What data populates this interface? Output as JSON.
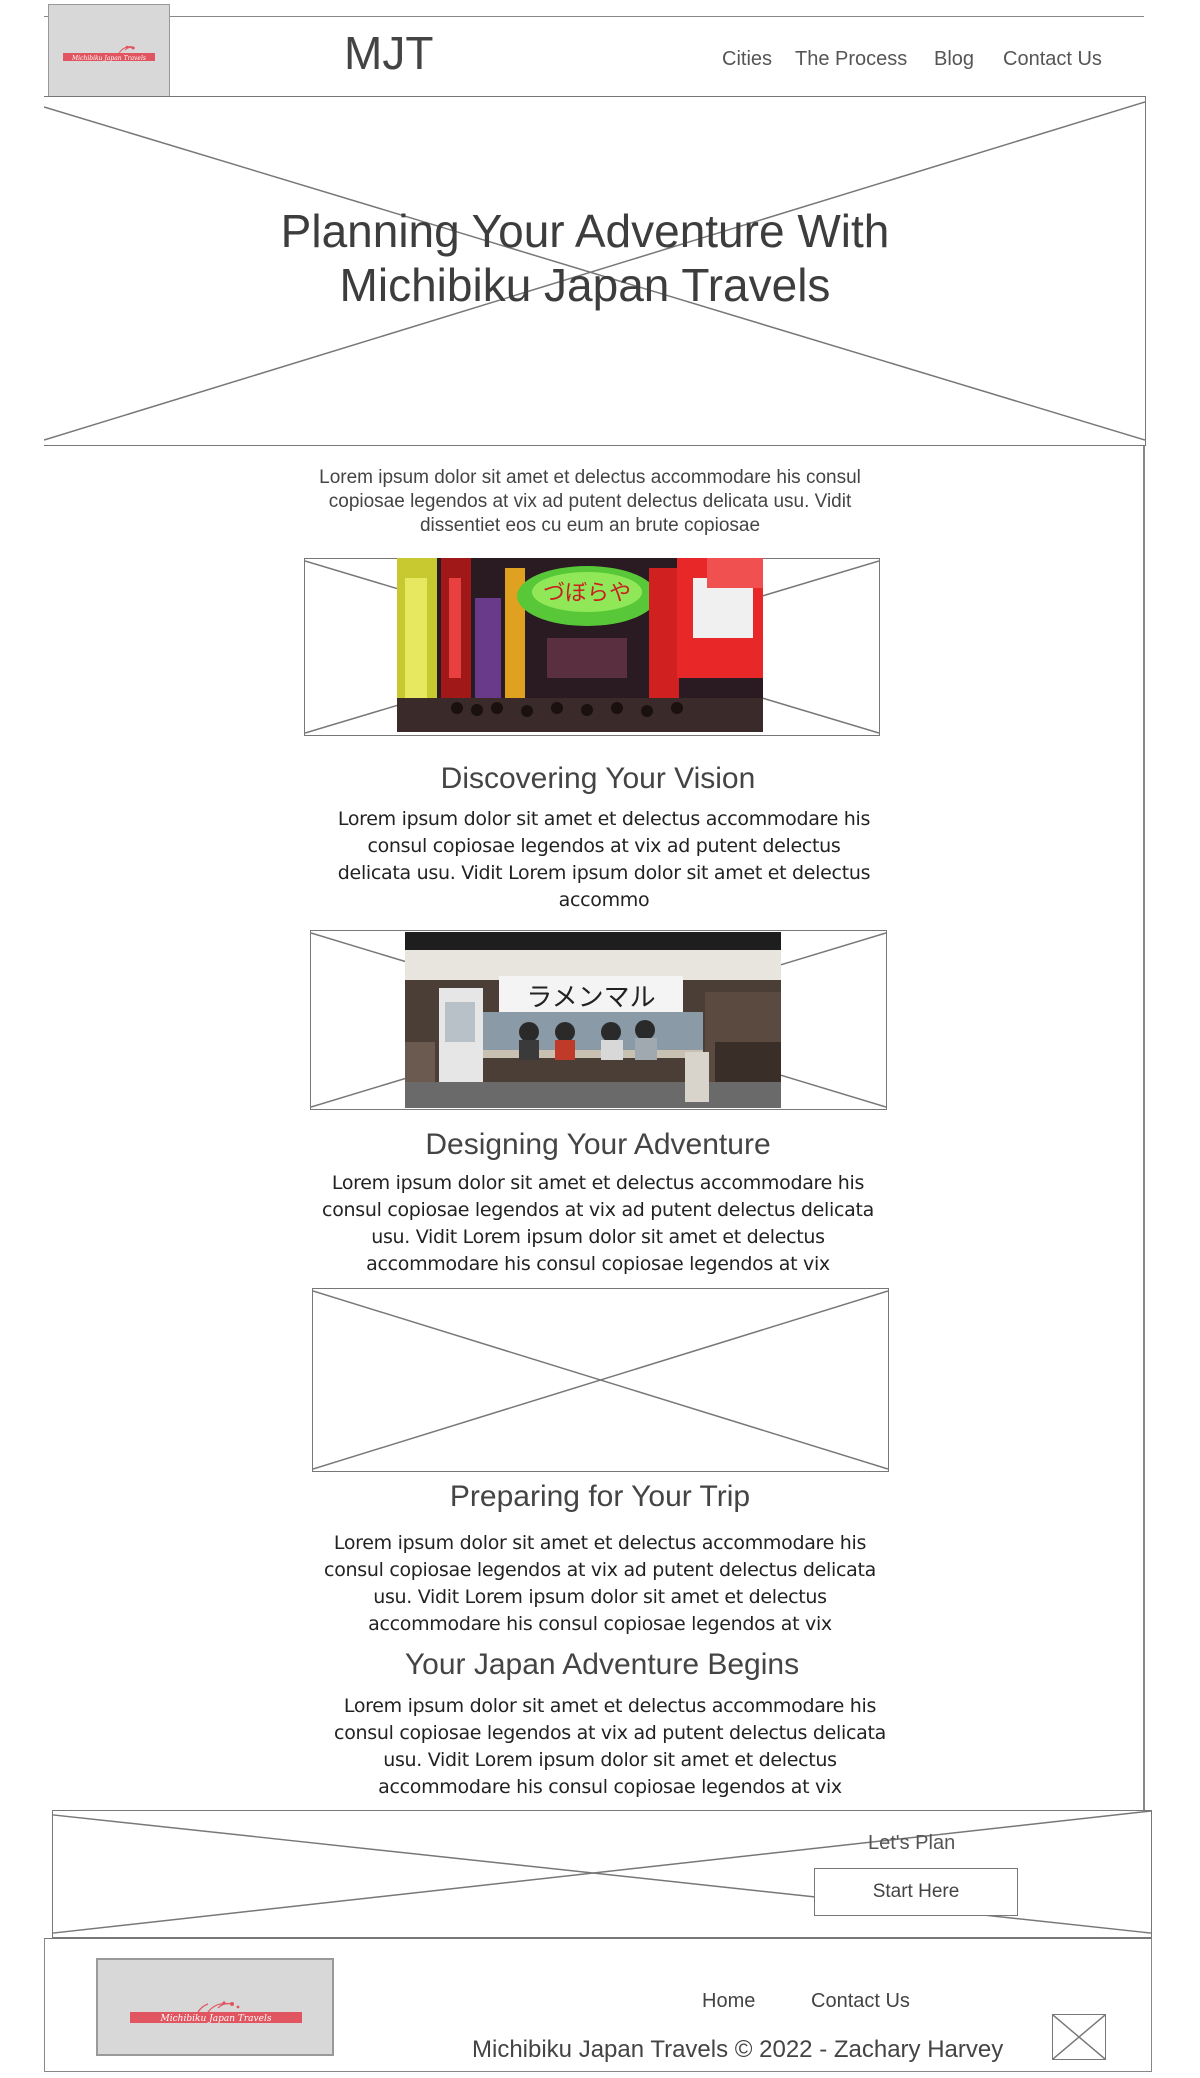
{
  "header": {
    "logo_text": "Michibiku Japan Travels",
    "brand": "MJT",
    "nav": [
      "Cities",
      "The Process",
      "Blog",
      "Contact Us"
    ]
  },
  "hero": {
    "title_line1": "Planning Your Adventure With",
    "title_line2": "Michibiku Japan Travels"
  },
  "intro": "Lorem ipsum dolor sit amet et delectus accommodare his consul copiosae legendos at vix ad putent delectus delicata usu. Vidit dissentiet eos cu eum an brute copiosae",
  "sections": [
    {
      "heading": "Discovering Your Vision",
      "body": "Lorem ipsum dolor sit amet et delectus accommodare his consul copiosae legendos at vix ad putent delectus delicata usu. Vidit Lorem ipsum dolor sit amet et delectus accommo"
    },
    {
      "heading": "Designing Your Adventure",
      "body": "Lorem ipsum dolor sit amet et delectus accommodare his consul copiosae legendos at vix ad putent delectus delicata usu. Vidit Lorem ipsum dolor sit amet et delectus accommodare his consul copiosae legendos at vix"
    },
    {
      "heading": "Preparing for Your Trip",
      "body": "Lorem ipsum dolor sit amet et delectus accommodare his consul copiosae legendos at vix ad putent delectus delicata usu. Vidit Lorem ipsum dolor sit amet et delectus accommodare his consul copiosae legendos at vix"
    },
    {
      "heading": "Your Japan Adventure Begins",
      "body": "Lorem ipsum dolor sit amet et delectus accommodare his consul copiosae legendos at vix ad putent delectus delicata usu. Vidit Lorem ipsum dolor sit amet et delectus accommodare his consul copiosae legendos at vix"
    }
  ],
  "photo_text": {
    "street_sign": "づぼらや",
    "ramen_sign": "ラメンマル"
  },
  "cta": {
    "label": "Let's Plan",
    "button": "Start Here"
  },
  "footer": {
    "logo_text": "Michibiku Japan Travels",
    "nav": [
      "Home",
      "Contact Us"
    ],
    "copyright": "Michibiku Japan Travels © 2022 - Zachary Harvey"
  },
  "colors": {
    "logo_accent": "#e05560",
    "placeholder_gray": "#d8d8d8",
    "wire": "#777777"
  }
}
